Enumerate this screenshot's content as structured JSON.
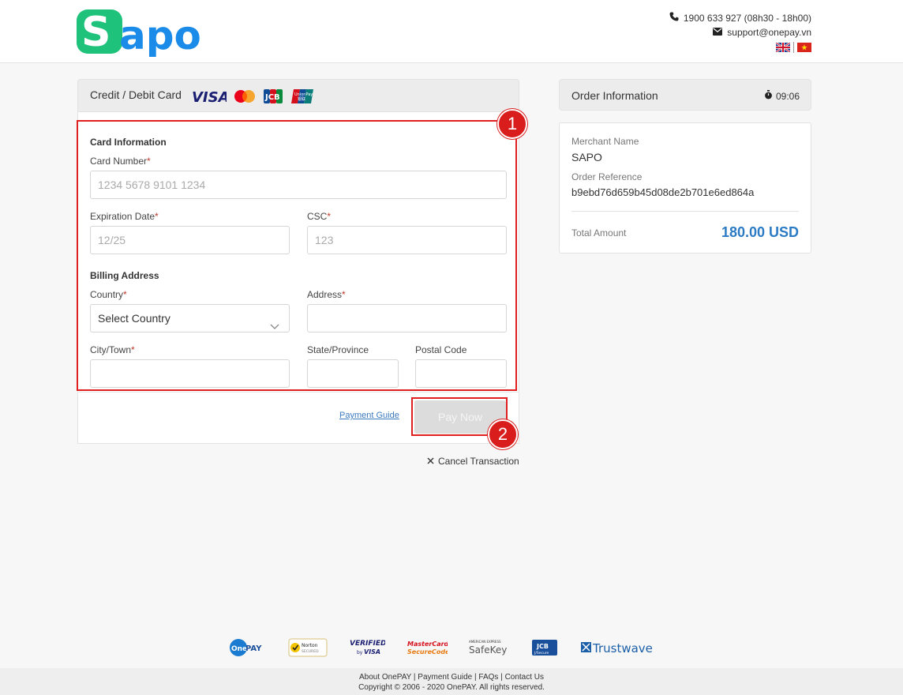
{
  "header": {
    "logo_text": "Sapo",
    "phone": "1900 633 927 (08h30 - 18h00)",
    "email": "support@onepay.vn",
    "flags": [
      "english-flag",
      "vietnamese-flag"
    ]
  },
  "payment": {
    "method_label": "Credit / Debit Card",
    "brands": [
      "VISA",
      "mastercard",
      "JCB",
      "UnionPay"
    ],
    "card_section_title": "Card Information",
    "card_number_label": "Card Number",
    "card_number_placeholder": "1234 5678 9101 1234",
    "exp_label": "Expiration Date",
    "exp_placeholder": "12/25",
    "csc_label": "CSC",
    "csc_placeholder": "123",
    "billing_section_title": "Billing Address",
    "country_label": "Country",
    "country_value": "Select Country",
    "address_label": "Address",
    "city_label": "City/Town",
    "state_label": "State/Province",
    "postal_label": "Postal Code",
    "required_mark": "*",
    "payment_guide": "Payment Guide",
    "pay_now": "Pay Now",
    "cancel": "Cancel Transaction"
  },
  "annotations": [
    "1",
    "2"
  ],
  "order": {
    "title": "Order Information",
    "timer": "09:06",
    "merchant_label": "Merchant Name",
    "merchant_value": "SAPO",
    "ref_label": "Order Reference",
    "ref_value": "b9ebd76d659b45d08de2b701e6ed864a",
    "total_label": "Total Amount",
    "total_value": "180.00 USD"
  },
  "footer": {
    "badges": [
      "OnePAY",
      "Norton Secured",
      "Verified by VISA",
      "MasterCard SecureCode",
      "American Express SafeKey",
      "JCB J/Secure",
      "Trustwave"
    ],
    "links": [
      "About OnePAY",
      "Payment Guide",
      "FAQs",
      "Contact Us"
    ],
    "copyright": "Copyright © 2006 - 2020 OnePAY. All rights reserved."
  },
  "colors": {
    "accent_blue": "#2a7bc4",
    "annotation_red": "#d91c1c",
    "sapo_green": "#1ec27a",
    "sapo_blue": "#1a8be8"
  }
}
